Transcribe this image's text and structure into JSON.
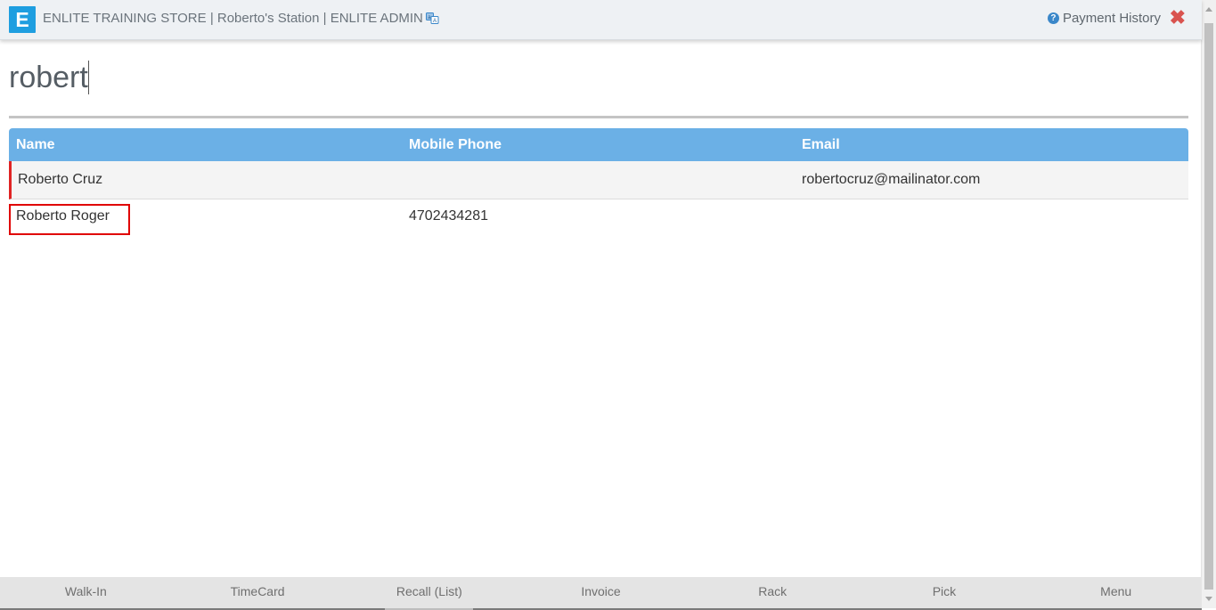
{
  "header": {
    "logo_letter": "E",
    "store_title": "ENLITE TRAINING STORE | Roberto's Station | ENLITE ADMIN",
    "translate_icon": "translate-icon",
    "payment_history_label": "Payment History",
    "help_icon": "question-circle-icon",
    "close_icon": "close-icon",
    "close_glyph": "✖",
    "close_color": "#d9534f",
    "accent_color": "#1e9ee0"
  },
  "search": {
    "value": "robert"
  },
  "table": {
    "header_color": "#6bb0e6",
    "columns": [
      "Name",
      "Mobile Phone",
      "Email"
    ],
    "rows": [
      {
        "name": "Roberto Cruz",
        "mobile_phone": "",
        "email": "robertocruz@mailinator.com",
        "selected": true
      },
      {
        "name": "Roberto Roger",
        "mobile_phone": "4702434281",
        "email": "",
        "highlighted": true
      }
    ]
  },
  "bottom_nav": {
    "items": [
      "Walk-In",
      "TimeCard",
      "Recall (List)",
      "Invoice",
      "Rack",
      "Pick",
      "Menu"
    ],
    "active_item": "Recall (List)"
  }
}
